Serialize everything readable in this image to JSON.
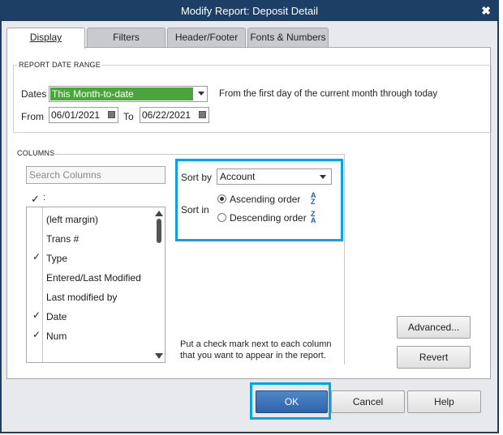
{
  "window": {
    "title": "Modify Report: Deposit Detail",
    "close_glyph": "✖"
  },
  "tabs": [
    {
      "label": "Display",
      "active": true
    },
    {
      "label": "Filters",
      "active": false
    },
    {
      "label": "Header/Footer",
      "active": false
    },
    {
      "label": "Fonts & Numbers",
      "active": false
    }
  ],
  "date_range": {
    "section_title": "REPORT DATE RANGE",
    "dates_label": "Dates",
    "dates_value": "This Month-to-date",
    "description": "From the first day of the current month through today",
    "from_label": "From",
    "from_value": "06/01/2021",
    "to_label": "To",
    "to_value": "06/22/2021"
  },
  "columns": {
    "section_title": "COLUMNS",
    "search_placeholder": "Search Columns",
    "check_header": "✓",
    "items": [
      {
        "label": "(left margin)",
        "checked": false
      },
      {
        "label": "Trans #",
        "checked": false
      },
      {
        "label": "Type",
        "checked": true
      },
      {
        "label": "Entered/Last Modified",
        "checked": false
      },
      {
        "label": "Last modified by",
        "checked": false
      },
      {
        "label": "Date",
        "checked": true
      },
      {
        "label": "Num",
        "checked": true
      }
    ],
    "check_glyph": "✓"
  },
  "sort": {
    "sort_by_label": "Sort by",
    "sort_by_value": "Account",
    "sort_in_label": "Sort in",
    "ascending_label": "Ascending order",
    "descending_label": "Descending order",
    "selected": "ascending",
    "asc_icon_top": "A",
    "asc_icon_bottom": "Z",
    "desc_icon_top": "Z",
    "desc_icon_bottom": "A"
  },
  "note": "Put a check mark next to each column that you want to appear in the report.",
  "buttons": {
    "advanced": "Advanced...",
    "revert": "Revert",
    "ok": "OK",
    "cancel": "Cancel",
    "help": "Help"
  },
  "colors": {
    "titlebar": "#1d3f66",
    "highlight_box": "#0aa2e0",
    "dates_selected_bg": "#4aa53a",
    "ok_button": "#2e63a8"
  }
}
